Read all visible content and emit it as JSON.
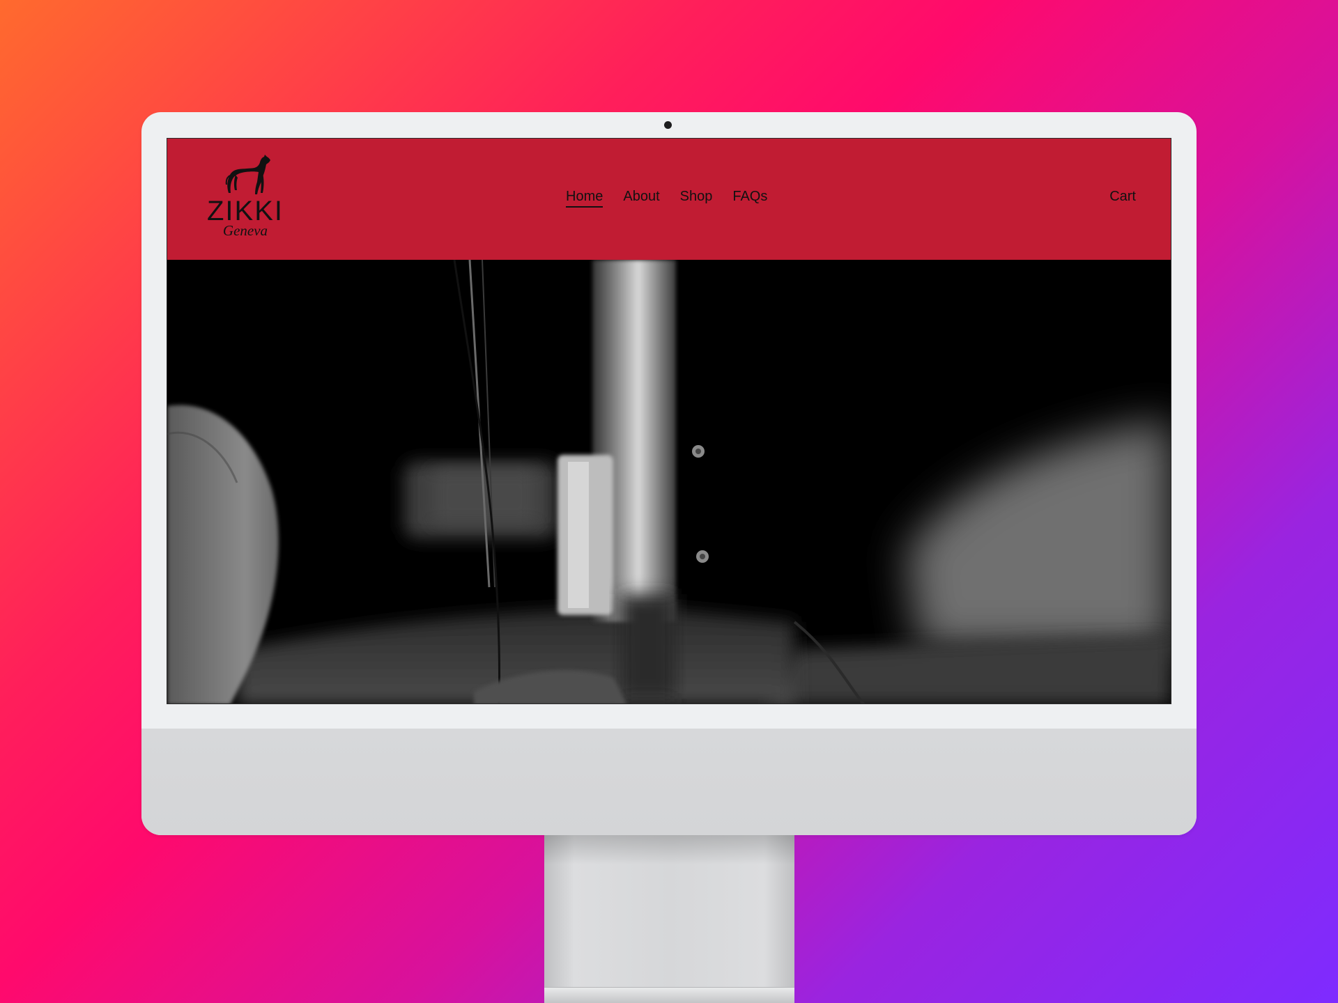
{
  "site": {
    "logo": {
      "wordmark": "ZIKKI",
      "subtitle": "Geneva"
    },
    "nav": {
      "items": [
        {
          "label": "Home",
          "active": true
        },
        {
          "label": "About",
          "active": false
        },
        {
          "label": "Shop",
          "active": false
        },
        {
          "label": "FAQs",
          "active": false
        }
      ]
    },
    "cart_label": "Cart",
    "hero": {
      "image": "black-and-white-sewing-machine-needle-closeup"
    }
  },
  "colors": {
    "header_background": "#c11c33",
    "text": "#111111",
    "page_gradient_start": "#ff6a2e",
    "page_gradient_mid": "#ff0a6c",
    "page_gradient_end": "#7e2bff",
    "monitor_body": "#eef0f2",
    "monitor_chin": "#d7d8da"
  },
  "icons": {
    "logo_mark": "greyhound-dog-icon",
    "camera": "camera-dot-icon"
  }
}
